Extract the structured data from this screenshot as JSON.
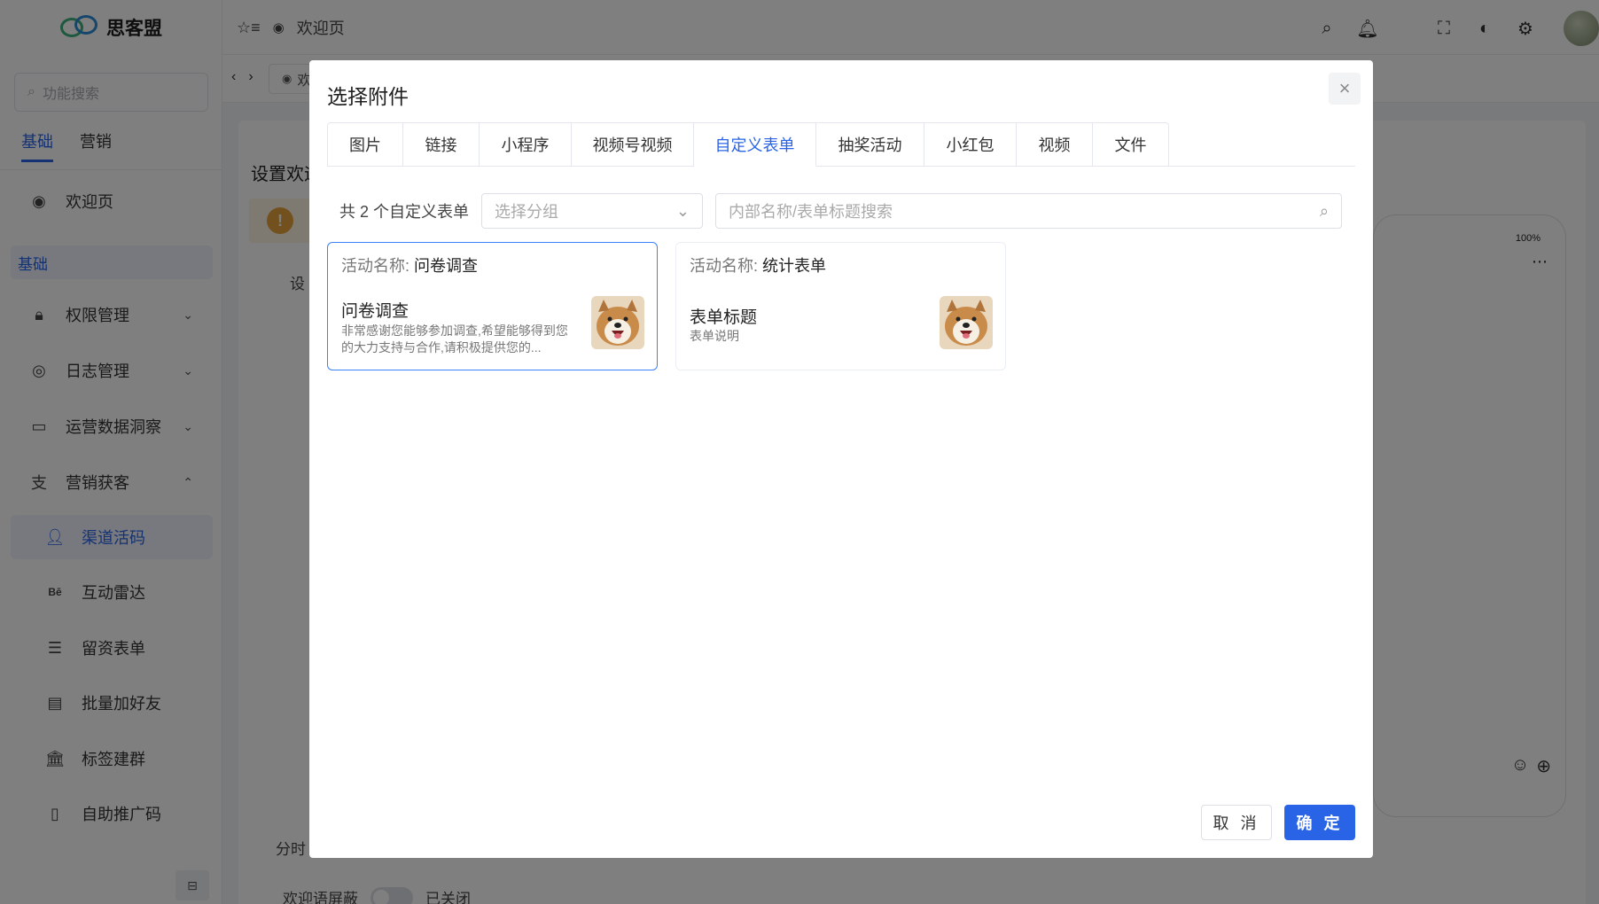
{
  "app": {
    "name": "思客盟",
    "search_placeholder": "功能搜索",
    "side_tabs": [
      "基础",
      "营销"
    ],
    "welcome_item": "欢迎页",
    "group_label": "基础",
    "menu": [
      {
        "label": "权限管理",
        "icon": "lock-icon",
        "chevron": "down"
      },
      {
        "label": "日志管理",
        "icon": "instagram-icon",
        "chevron": "down"
      },
      {
        "label": "运营数据洞察",
        "icon": "monitor-icon",
        "chevron": "down"
      },
      {
        "label": "营销获客",
        "icon": "alipay-icon",
        "chevron": "up"
      }
    ],
    "submenu": [
      {
        "label": "渠道活码",
        "icon": "user-icon",
        "selected": true
      },
      {
        "label": "互动雷达",
        "icon": "behance-icon",
        "selected": false
      },
      {
        "label": "留资表单",
        "icon": "list-icon",
        "selected": false
      },
      {
        "label": "批量加好友",
        "icon": "clipboard-icon",
        "selected": false
      },
      {
        "label": "标签建群",
        "icon": "bank-icon",
        "selected": false
      },
      {
        "label": "自助推广码",
        "icon": "bookmark-icon",
        "selected": false
      }
    ]
  },
  "topbar": {
    "page_label": "欢迎页",
    "tab_label": "欢"
  },
  "background": {
    "panel_title": "设置欢迎",
    "label_setting": "设",
    "label_split": "分时",
    "toggle_label": "欢迎语屏蔽",
    "toggle_state": "已关闭",
    "phone_battery": "100%"
  },
  "modal": {
    "title": "选择附件",
    "tabs": [
      "图片",
      "链接",
      "小程序",
      "视频号视频",
      "自定义表单",
      "抽奖活动",
      "小红包",
      "视频",
      "文件"
    ],
    "active_tab": "自定义表单",
    "count_text": "共 2 个自定义表单",
    "group_placeholder": "选择分组",
    "search_placeholder": "内部名称/表单标题搜索",
    "cards": [
      {
        "name_label": "活动名称:",
        "name": "问卷调查",
        "title": "问卷调查",
        "desc": "非常感谢您能够参加调查,希望能够得到您的大力支持与合作,请积极提供您的...",
        "selected": true
      },
      {
        "name_label": "活动名称:",
        "name": "统计表单",
        "title": "表单标题",
        "desc": "表单说明",
        "selected": false
      }
    ],
    "cancel_label": "取 消",
    "confirm_label": "确 定"
  },
  "colors": {
    "accent": "#2a64e6",
    "overlay": "rgba(0,0,0,0.5)",
    "warning": "#e6a23c"
  }
}
